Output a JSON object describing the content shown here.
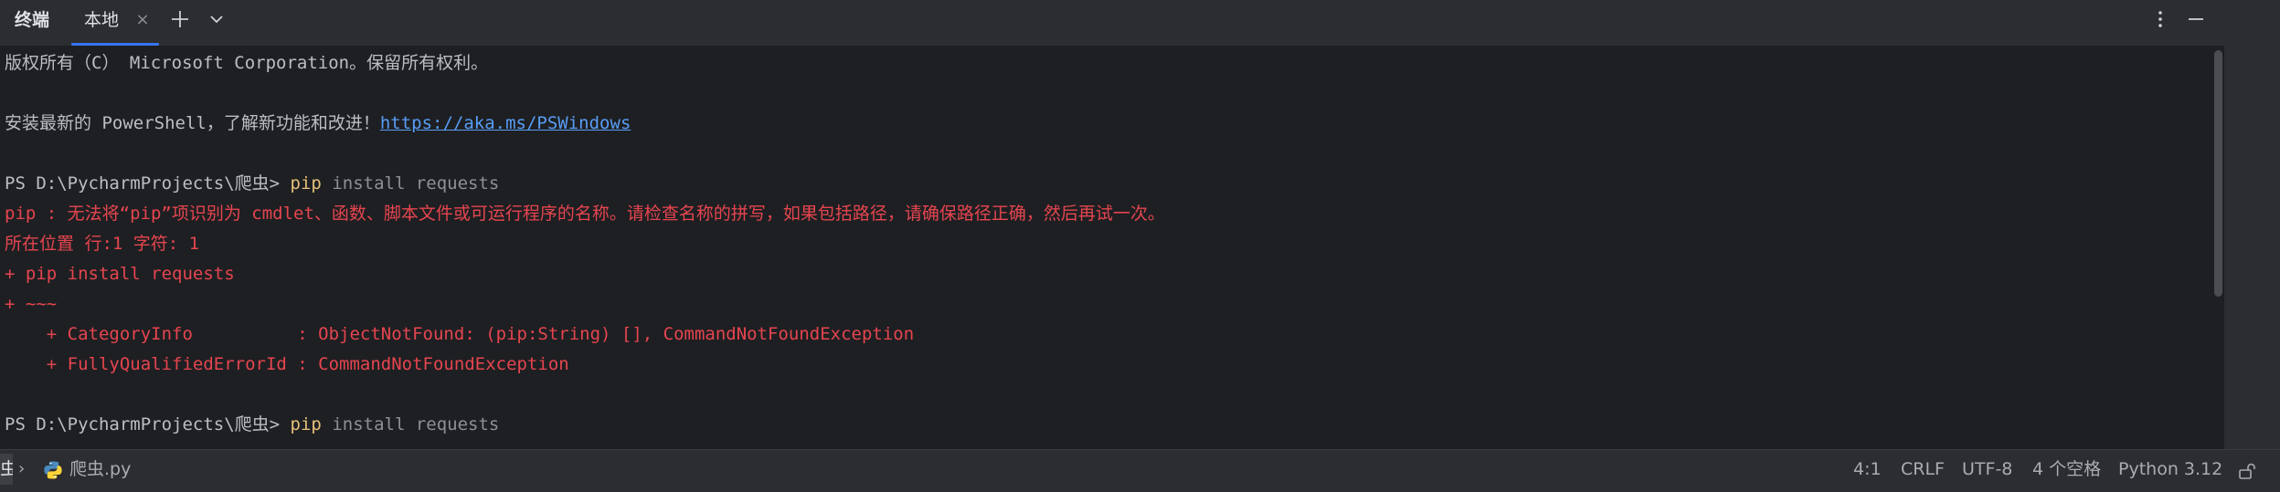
{
  "tabbar": {
    "tool_window_title": "终端",
    "tabs": [
      {
        "label": "本地",
        "close_glyph": "×"
      }
    ],
    "add_icon": "plus-icon",
    "chevron_icon": "chevron-down-icon",
    "more_icon": "more-vertical-icon",
    "minimize_icon": "minimize-icon"
  },
  "terminal": {
    "line_copyright": "版权所有（C） Microsoft Corporation。保留所有权利。",
    "install_text": "安装最新的 PowerShell，了解新功能和改进！",
    "install_link": "https://aka.ms/PSWindows",
    "prompt_1": "PS D:\\PycharmProjects\\爬虫> ",
    "cmd_1_name": "pip",
    "cmd_1_args": " install requests",
    "error_1": "pip : 无法将“pip”项识别为 cmdlet、函数、脚本文件或可运行程序的名称。请检查名称的拼写，如果包括路径，请确保路径正确，然后再试一次。",
    "error_2": "所在位置 行:1 字符: 1",
    "error_3": "+ pip install requests",
    "error_4": "+ ~~~",
    "error_5": "    + CategoryInfo          : ObjectNotFound: (pip:String) [], CommandNotFoundException",
    "error_6": "    + FullyQualifiedErrorId : CommandNotFoundException",
    "prompt_2": "PS D:\\PycharmProjects\\爬虫> ",
    "cmd_2_name": "pip",
    "cmd_2_args": " install requests",
    "colors": {
      "background": "#1e1f22",
      "text": "#bcbec4",
      "error": "#e5454f",
      "command": "#e5c07b",
      "link": "#589df6",
      "accent": "#3574f0"
    }
  },
  "statusbar": {
    "breadcrumb_prev": "虫",
    "breadcrumb_sep": "›",
    "file_icon": "python-file-icon",
    "file_name": "爬虫.py",
    "cursor_position": "4:1",
    "line_separator": "CRLF",
    "encoding": "UTF-8",
    "indent": "4 个空格",
    "interpreter": "Python 3.12",
    "lock_icon": "unlock-icon"
  }
}
